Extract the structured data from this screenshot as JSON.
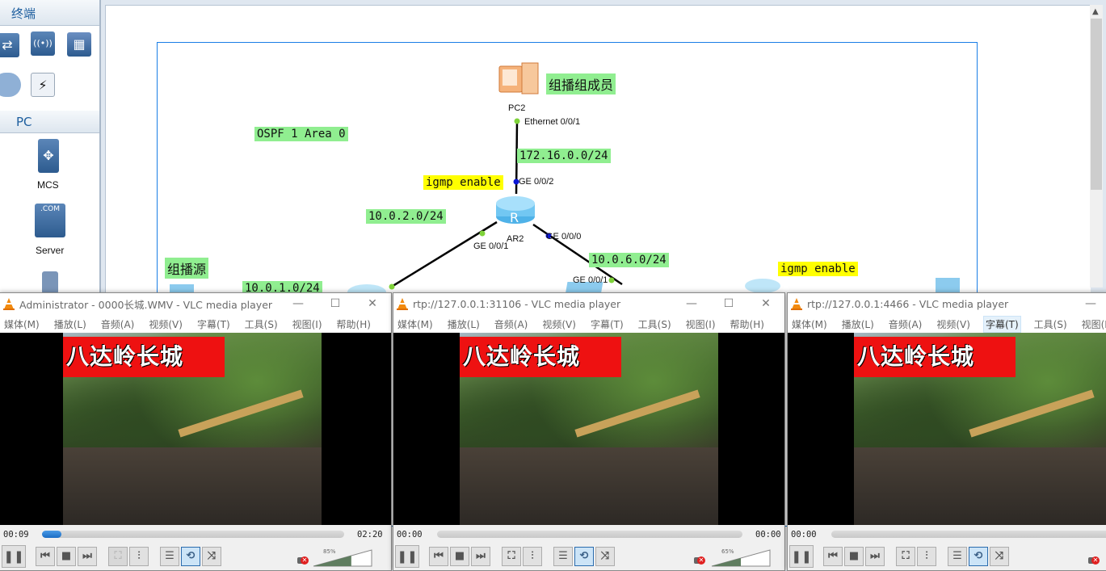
{
  "sidebar": {
    "section_terminal": "终端",
    "section_pc": "PC",
    "icons": [
      {
        "name": "router-icon",
        "glyph": "⇄"
      },
      {
        "name": "wireless-ap-icon",
        "glyph": "((•))"
      },
      {
        "name": "firewall-icon",
        "glyph": "▦"
      },
      {
        "name": "cloud-icon",
        "glyph": "☁"
      },
      {
        "name": "power-icon",
        "glyph": "⚡"
      }
    ],
    "devices": [
      {
        "label": "MCS",
        "icon": "mcs-server-icon"
      },
      {
        "label": "Server",
        "icon": "com-server-icon"
      }
    ]
  },
  "topology": {
    "labels_green": {
      "pc2_role": "组播组成员",
      "source_role": "组播源",
      "ospf": "OSPF 1 Area 0",
      "net_172": "172.16.0.0/24",
      "net_10_2": "10.0.2.0/24",
      "net_10_1": "10.0.1.0/24",
      "net_10_6": "10.0.6.0/24"
    },
    "labels_yellow": {
      "igmp_ar2": "igmp enable",
      "igmp_right": "igmp enable"
    },
    "devices": {
      "pc2": "PC2",
      "ar2": "AR2"
    },
    "ports": {
      "pc2_eth": "Ethernet 0/0/1",
      "ar2_ge002": "GE 0/0/2",
      "ar2_ge001": "GE 0/0/1",
      "ar2_ge000": "GE 0/0/0",
      "sw_ge001": "GE 0/0/1"
    },
    "link_colors": {
      "up": "#7fd33a",
      "down": "#0b16d6"
    }
  },
  "vlc_windows": [
    {
      "title": "Administrator - 0000长城.WMV - VLC media player",
      "menus": [
        "媒体(M)",
        "播放(L)",
        "音频(A)",
        "视频(V)",
        "字幕(T)",
        "工具(S)",
        "视图(I)",
        "帮助(H)"
      ],
      "active_menu": -1,
      "banner": "八达岭长城",
      "elapsed": "00:09",
      "duration": "02:20",
      "progress": 0.064,
      "volume": "85%",
      "volume_level": 0.65
    },
    {
      "title": "rtp://127.0.0.1:31106 - VLC media player",
      "menus": [
        "媒体(M)",
        "播放(L)",
        "音频(A)",
        "视频(V)",
        "字幕(T)",
        "工具(S)",
        "视图(I)",
        "帮助(H)"
      ],
      "active_menu": -1,
      "banner": "八达岭长城",
      "elapsed": "00:00",
      "duration": "00:00",
      "progress": 0,
      "volume": "65%",
      "volume_level": 0.5
    },
    {
      "title": "rtp://127.0.0.1:4466 - VLC media player",
      "menus": [
        "媒体(M)",
        "播放(L)",
        "音频(A)",
        "视频(V)",
        "字幕(T)",
        "工具(S)",
        "视图(I)"
      ],
      "active_menu": 4,
      "banner": "八达岭长城",
      "elapsed": "00:00",
      "duration": "",
      "progress": 0,
      "volume": "",
      "volume_level": 0
    }
  ],
  "controls": {
    "pause": "❚❚",
    "prev": "⏮",
    "stop": "■",
    "next": "⏭",
    "fullscreen": "⛶",
    "ext_settings": "⫶",
    "playlist": "☰",
    "loop": "⟲",
    "random": "⤨",
    "minimize": "—",
    "maximize": "☐",
    "close": "✕"
  }
}
